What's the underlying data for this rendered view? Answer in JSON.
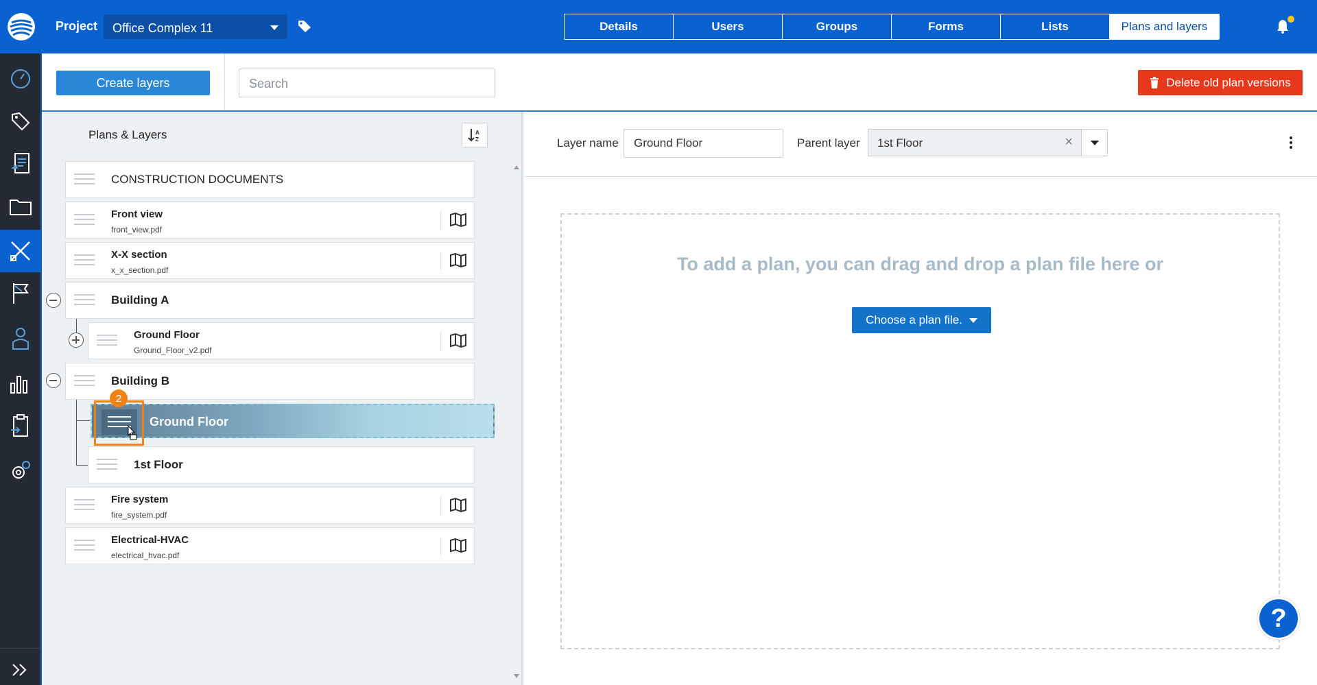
{
  "header": {
    "project_label": "Project",
    "project_name": "Office Complex 11",
    "tabs": [
      "Details",
      "Users",
      "Groups",
      "Forms",
      "Lists",
      "Plans and layers"
    ],
    "active_tab": "Plans and layers"
  },
  "toolbar": {
    "create_label": "Create layers",
    "search_placeholder": "Search",
    "delete_label": "Delete old plan versions"
  },
  "tree": {
    "title": "Plans & Layers",
    "items": [
      {
        "name": "CONSTRUCTION DOCUMENTS"
      },
      {
        "name": "Front view",
        "file": "front_view.pdf"
      },
      {
        "name": "X-X section",
        "file": "x_x_section.pdf"
      },
      {
        "name": "Building A"
      },
      {
        "name": "Ground Floor",
        "file": "Ground_Floor_v2.pdf"
      },
      {
        "name": "Building B"
      },
      {
        "name": "Ground Floor"
      },
      {
        "name": "1st Floor"
      },
      {
        "name": "Fire system",
        "file": "fire_system.pdf"
      },
      {
        "name": "Electrical-HVAC",
        "file": "electrical_hvac.pdf"
      }
    ],
    "step_badge": "2"
  },
  "detail": {
    "layer_name_label": "Layer name",
    "layer_name_value": "Ground Floor",
    "parent_layer_label": "Parent layer",
    "parent_layer_value": "1st Floor",
    "clear_symbol": "×",
    "drop_message": "To add a plan, you can drag and drop a plan file here or",
    "choose_label": "Choose a plan file.",
    "help_symbol": "?"
  },
  "colors": {
    "brand_blue": "#0a62d0",
    "danger": "#e8381c",
    "highlight": "#f08317"
  }
}
